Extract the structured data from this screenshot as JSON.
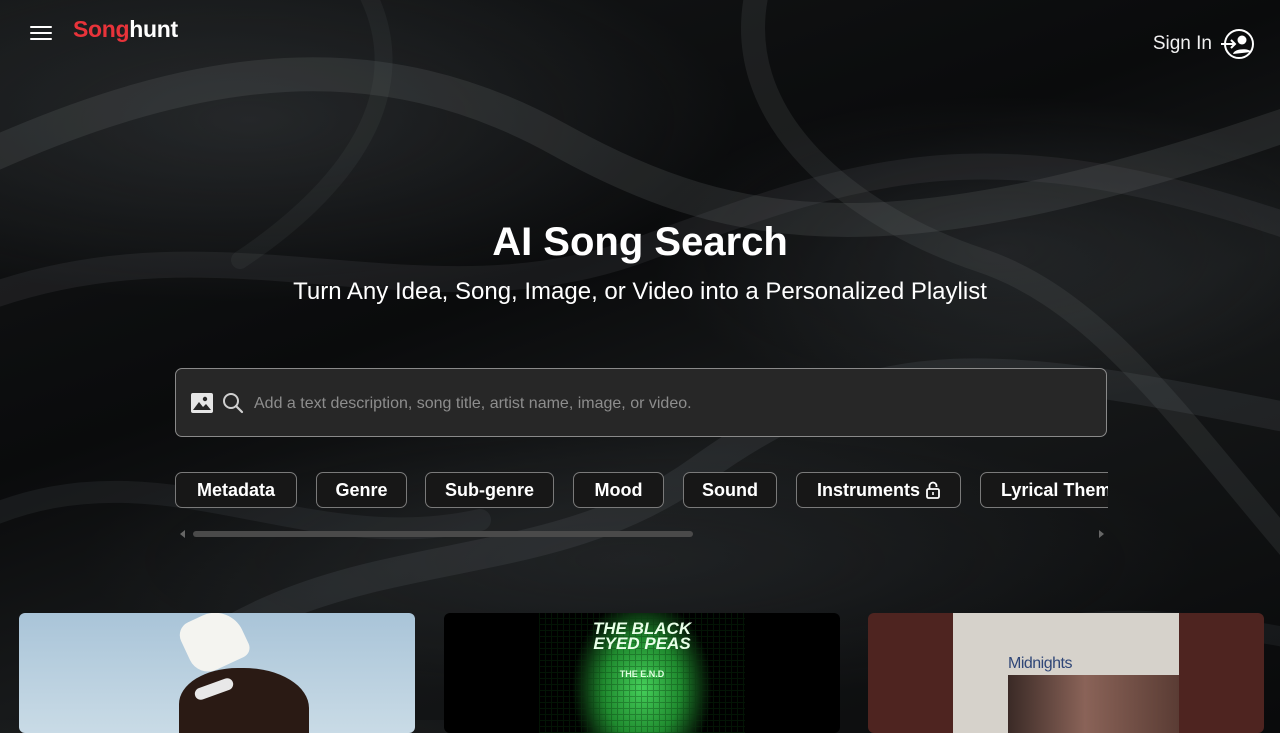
{
  "header": {
    "logo_part1": "Song",
    "logo_part2": "hunt",
    "menu_icon": "hamburger-menu-icon",
    "signin_label": "Sign In",
    "signin_icon": "user-sign-in-icon"
  },
  "hero": {
    "title": "AI Song Search",
    "subtitle": "Turn Any Idea, Song, Image, or Video into a Personalized Playlist"
  },
  "search": {
    "placeholder": "Add a text description, song title, artist name, image, or video.",
    "value": "",
    "image_icon": "image-upload-icon",
    "search_icon": "search-icon"
  },
  "filters": [
    {
      "label": "Metadata",
      "locked": false
    },
    {
      "label": "Genre",
      "locked": false
    },
    {
      "label": "Sub-genre",
      "locked": false
    },
    {
      "label": "Mood",
      "locked": false
    },
    {
      "label": "Sound",
      "locked": false
    },
    {
      "label": "Instruments",
      "locked": true
    },
    {
      "label": "Lyrical Theme",
      "locked": false
    }
  ],
  "cards": [
    {
      "album_text": ""
    },
    {
      "album_text": "THE BLACK EYED PEAS",
      "album_sub": "THE E.N.D"
    },
    {
      "album_text": "Midnights"
    }
  ],
  "colors": {
    "brand_red": "#e8333a",
    "search_bg": "#272727",
    "chip_border": "#7a7a7a"
  }
}
